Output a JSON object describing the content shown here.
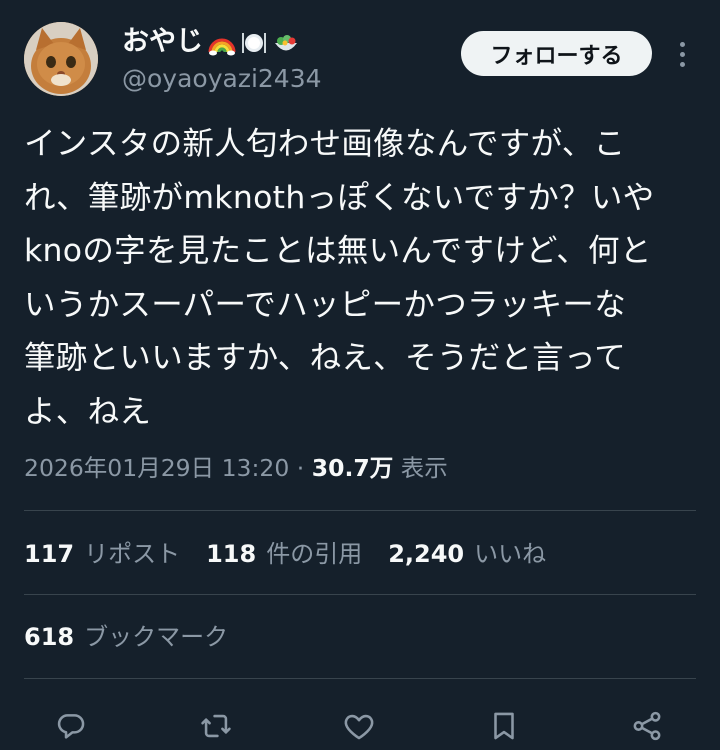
{
  "author": {
    "display_name": "おやじ",
    "name_emojis": [
      "rainbow-emoji",
      "plate-cutlery-emoji",
      "salad-emoji"
    ],
    "handle": "@oyaoyazi2434",
    "avatar": "cat-avatar"
  },
  "header": {
    "follow_label": "フォローする",
    "more_icon": "more-vertical-icon"
  },
  "tweet": {
    "text": "インスタの新人匂わせ画像なんですが、こ\nれ、筆跡がmknothっぽくないですか？いや\nknoの字を見たことは無いんですけど、何と\nいうかスーパーでハッピーかつラッキーな\n筆跡といいますか、ねえ、そうだと言って\nよ、ねえ",
    "datetime": "2026年01月29日 13:20",
    "separator": "·",
    "views_count": "30.7万",
    "views_label": "表示"
  },
  "stats": {
    "reposts_count": "117",
    "reposts_label": "リポスト",
    "quotes_count": "118",
    "quotes_label": "件の引用",
    "likes_count": "2,240",
    "likes_label": "いいね",
    "bookmarks_count": "618",
    "bookmarks_label": "ブックマーク"
  },
  "actions": [
    "reply-icon",
    "repost-icon",
    "like-icon",
    "bookmark-icon",
    "share-icon"
  ],
  "colors": {
    "background": "#15202b",
    "text": "#f7f9f9",
    "secondary_text": "#8b98a5",
    "divider": "#38444d",
    "follow_button_bg": "#eff3f4"
  }
}
